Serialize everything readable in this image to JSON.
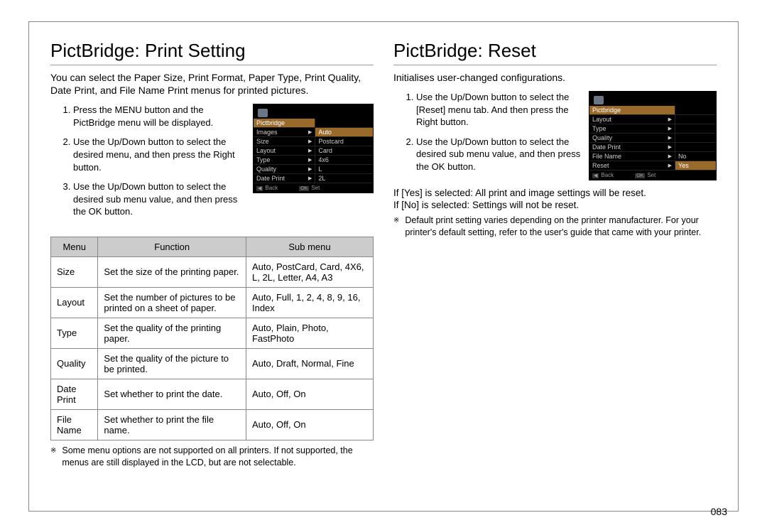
{
  "left": {
    "title": "PictBridge: Print Setting",
    "intro": "You can select the Paper Size, Print Format, Paper Type, Print Quality, Date Print, and File Name Print menus for printed pictures.",
    "steps": [
      "Press the MENU button and the PictBridge menu will be displayed.",
      "Use the Up/Down button to select the desired menu, and then press the Right button.",
      "Use the Up/Down button to select the desired sub menu value, and then press the OK button."
    ],
    "table": {
      "headers": [
        "Menu",
        "Function",
        "Sub menu"
      ],
      "rows": [
        {
          "menu": "Size",
          "func": "Set the size of the printing paper.",
          "sub": "Auto, PostCard, Card, 4X6, L, 2L, Letter, A4, A3"
        },
        {
          "menu": "Layout",
          "func": "Set the number of pictures to be printed on a sheet of paper.",
          "sub": "Auto, Full, 1, 2, 4, 8, 9, 16, Index"
        },
        {
          "menu": "Type",
          "func": "Set the quality of the printing paper.",
          "sub": "Auto, Plain, Photo, FastPhoto"
        },
        {
          "menu": "Quality",
          "func": "Set the quality of the picture to be printed.",
          "sub": "Auto, Draft, Normal, Fine"
        },
        {
          "menu": "Date Print",
          "func": "Set whether to print the date.",
          "sub": "Auto, Off, On"
        },
        {
          "menu": "File Name",
          "func": "Set whether to print the file name.",
          "sub": "Auto, Off, On"
        }
      ]
    },
    "note": "Some menu options are not supported on all printers. If not supported, the menus are still displayed in the LCD, but are not selectable.",
    "screenshot": {
      "title": "Pictbridge",
      "rows": [
        {
          "l": "Images",
          "r": "Auto",
          "hl": true
        },
        {
          "l": "Size",
          "r": "Postcard"
        },
        {
          "l": "Layout",
          "r": "Card"
        },
        {
          "l": "Type",
          "r": "4x6"
        },
        {
          "l": "Quality",
          "r": "L"
        },
        {
          "l": "Date Print",
          "r": "2L"
        }
      ],
      "back": "Back",
      "ok": "OK",
      "set": "Set"
    }
  },
  "right": {
    "title": "PictBridge: Reset",
    "intro": "Initialises user-changed configurations.",
    "steps": [
      "Use the Up/Down button to select the [Reset] menu tab. And then press the Right button.",
      "Use the Up/Down button to select the desired sub menu value, and then press the OK button."
    ],
    "result_yes": "If [Yes] is selected:   All print and image settings will be reset.",
    "result_no": "If [No] is selected: Settings will not be reset.",
    "note": "Default print setting varies depending on the printer manufacturer. For your printer's default setting, refer to the user's guide that came with your printer.",
    "screenshot": {
      "title": "Pictbridge",
      "rows": [
        {
          "l": "Layout",
          "r": ""
        },
        {
          "l": "Type",
          "r": ""
        },
        {
          "l": "Quality",
          "r": ""
        },
        {
          "l": "Date Print",
          "r": ""
        },
        {
          "l": "File Name",
          "r": "No"
        },
        {
          "l": "Reset",
          "r": "Yes",
          "hl": true
        }
      ],
      "back": "Back",
      "ok": "OK",
      "set": "Set"
    }
  },
  "pagenum": "083"
}
